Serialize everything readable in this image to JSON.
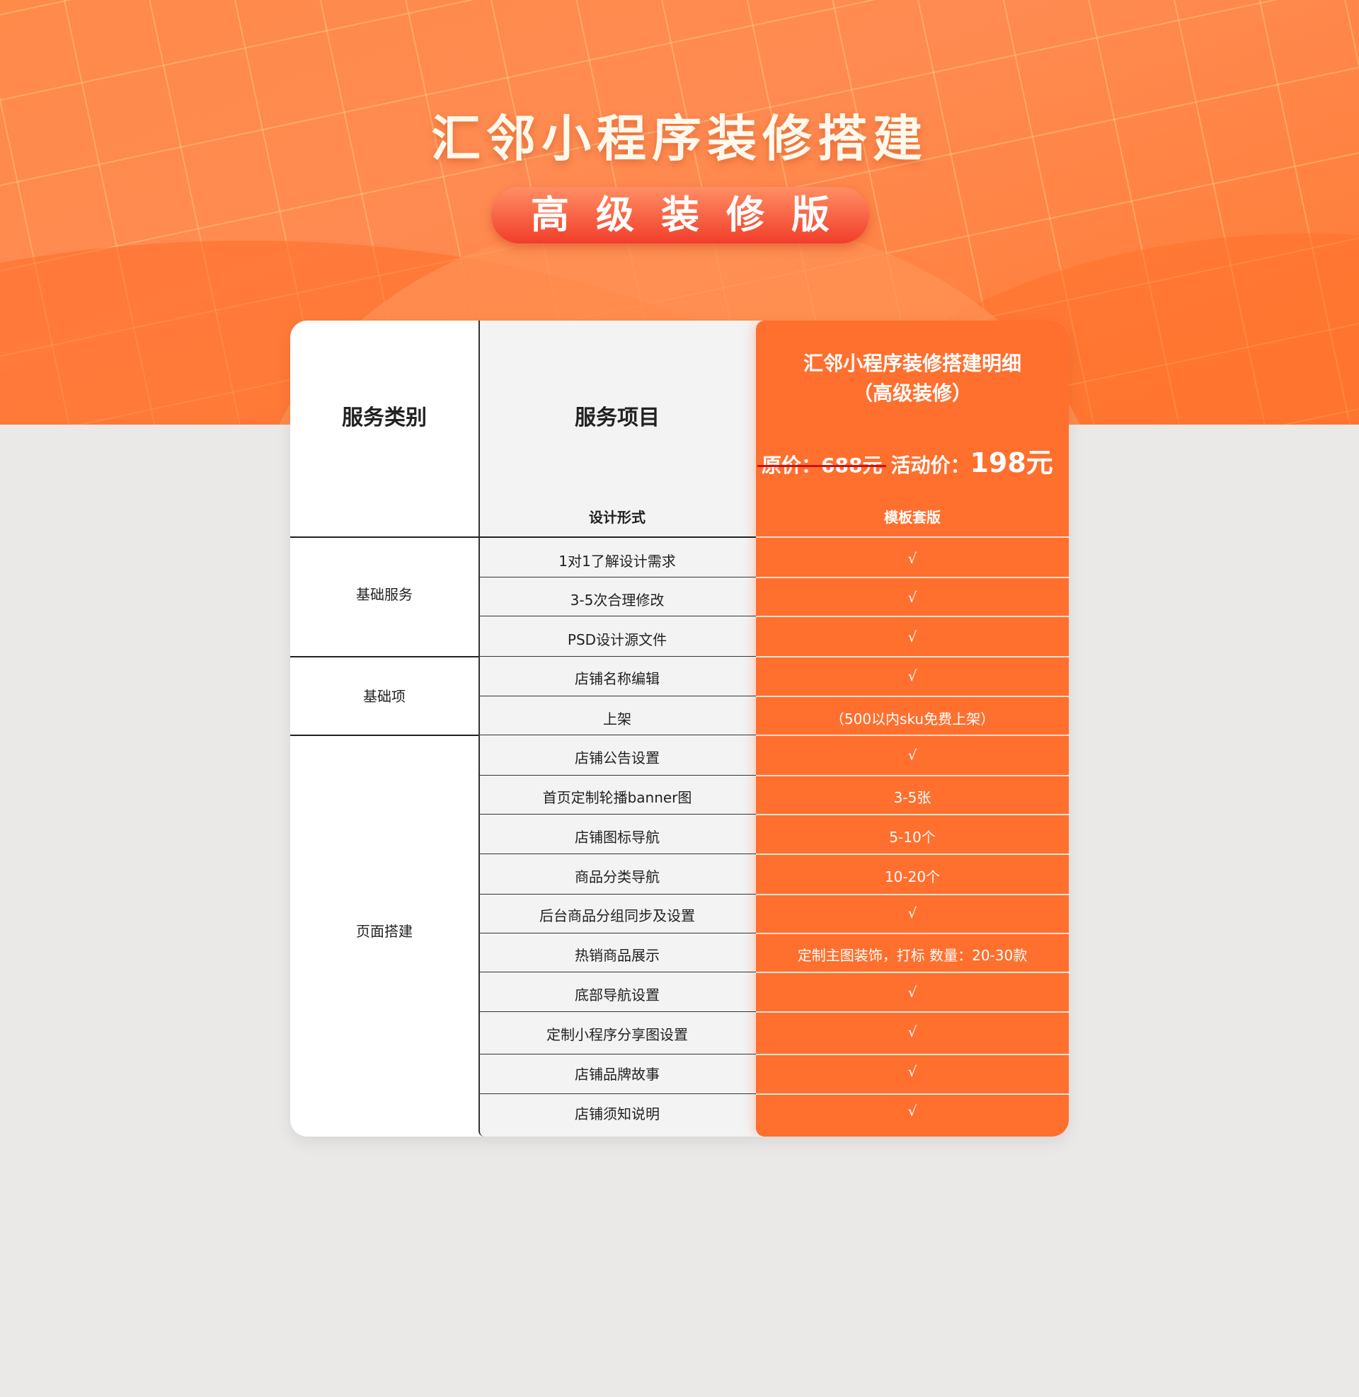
{
  "header": {
    "title": "汇邻小程序装修搭建",
    "badge": "高级装修版"
  },
  "table": {
    "col_category": "服务类别",
    "col_item": "服务项目",
    "plan": {
      "title_line1": "汇邻小程序装修搭建明细",
      "title_line2": "（高级装修）",
      "original_price": "原价：688元",
      "sale_label": "活动价：",
      "sale_price": "198元"
    },
    "subheader": {
      "item": "设计形式",
      "plan": "模板套版"
    },
    "categories": [
      {
        "label": "基础服务"
      },
      {
        "label": "基础项"
      },
      {
        "label": "页面搭建"
      }
    ],
    "rows": [
      {
        "item": "1对1了解设计需求",
        "value": "√"
      },
      {
        "item": "3-5次合理修改",
        "value": "√"
      },
      {
        "item": "PSD设计源文件",
        "value": "√"
      },
      {
        "item": "店铺名称编辑",
        "value": "√"
      },
      {
        "item": "上架",
        "value": "（500以内sku免费上架）"
      },
      {
        "item": "店铺公告设置",
        "value": "√"
      },
      {
        "item": "首页定制轮播banner图",
        "value": "3-5张"
      },
      {
        "item": "店铺图标导航",
        "value": "5-10个"
      },
      {
        "item": "商品分类导航",
        "value": "10-20个"
      },
      {
        "item": "后台商品分组同步及设置",
        "value": "√"
      },
      {
        "item": "热销商品展示",
        "value": "定制主图装饰，打标 数量：20-30款"
      },
      {
        "item": "底部导航设置",
        "value": "√"
      },
      {
        "item": "定制小程序分享图设置",
        "value": "√"
      },
      {
        "item": "店铺品牌故事",
        "value": "√"
      },
      {
        "item": "店铺须知说明",
        "value": "√"
      }
    ]
  }
}
